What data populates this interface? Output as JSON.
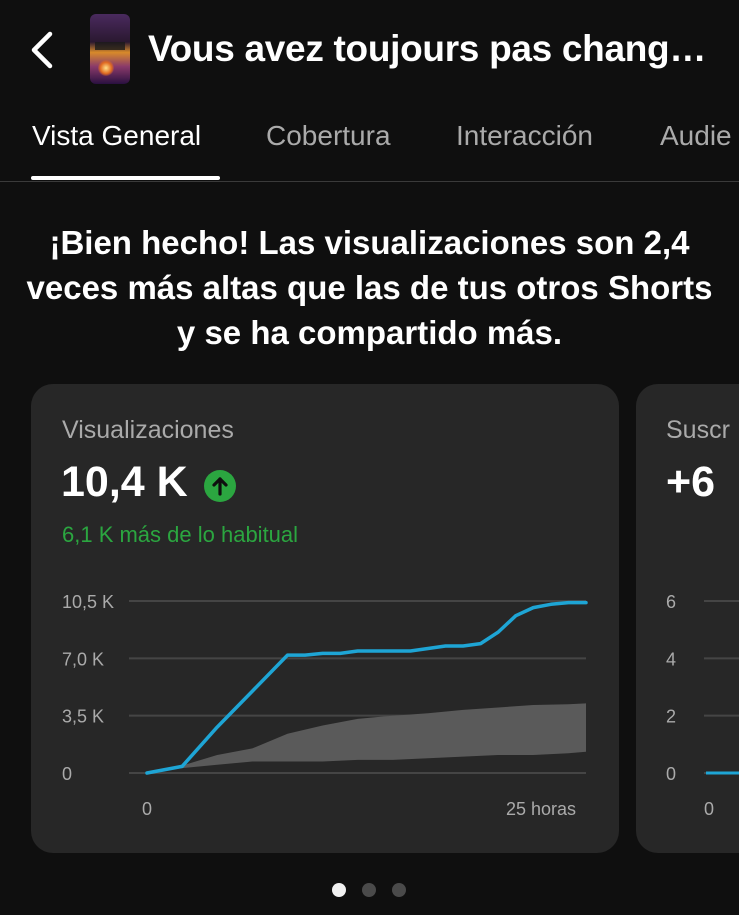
{
  "header": {
    "title": "Vous avez toujours pas chang…",
    "back_icon": "back-arrow-icon",
    "thumbnail": "video-thumbnail"
  },
  "tabs": [
    {
      "label": "Vista General",
      "active": true
    },
    {
      "label": "Cobertura",
      "active": false
    },
    {
      "label": "Interacción",
      "active": false
    },
    {
      "label": "Audie",
      "active": false
    }
  ],
  "headline": "¡Bien hecho! Las visualizaciones son 2,4 veces más altas que las de tus otros Shorts y se ha compartido más.",
  "cards": [
    {
      "label": "Visualizaciones",
      "value": "10,4 K",
      "trend_icon": "arrow-up-icon",
      "note": "6,1 K más de lo habitual",
      "note_color": "#2ba640"
    },
    {
      "label": "Suscr",
      "value": "+6"
    }
  ],
  "colors": {
    "background": "#0f0f0f",
    "card": "#272727",
    "line": "#1ea5d5",
    "typical_band": "#5a5a5a",
    "positive": "#2ba640"
  },
  "chart_data": [
    {
      "type": "line",
      "title": "Visualizaciones",
      "x_unit": "horas",
      "xlim": [
        0,
        25
      ],
      "ylim": [
        0,
        10500
      ],
      "y_ticks": [
        0,
        3500,
        7000,
        10500
      ],
      "y_tick_labels": [
        "0",
        "3,5 K",
        "7,0 K",
        "10,5 K"
      ],
      "x_tick_labels": [
        "0",
        "25 horas"
      ],
      "grid": true,
      "series": [
        {
          "kind": "line",
          "x": [
            0,
            2,
            4,
            6,
            8,
            9,
            10,
            11,
            12,
            13,
            15,
            16,
            17,
            18,
            19,
            20,
            21,
            22,
            23,
            24,
            25
          ],
          "values": [
            0,
            400,
            2800,
            5000,
            7200,
            7200,
            7300,
            7300,
            7450,
            7450,
            7450,
            7600,
            7750,
            7750,
            7900,
            8600,
            9600,
            10100,
            10300,
            10400,
            10400
          ]
        },
        {
          "kind": "band",
          "x": [
            0,
            2,
            4,
            6,
            8,
            10,
            12,
            14,
            16,
            18,
            20,
            22,
            24,
            25
          ],
          "low": [
            0,
            300,
            500,
            700,
            700,
            700,
            800,
            800,
            900,
            1000,
            1100,
            1100,
            1200,
            1300
          ],
          "high": [
            0,
            450,
            1100,
            1500,
            2400,
            2900,
            3300,
            3500,
            3650,
            3850,
            4000,
            4150,
            4200,
            4250
          ]
        }
      ]
    },
    {
      "type": "line",
      "title": "Suscr",
      "ylim": [
        0,
        6
      ],
      "y_ticks": [
        0,
        2,
        4,
        6
      ],
      "y_tick_labels": [
        "0",
        "2",
        "4",
        "6"
      ],
      "x_tick_labels": [
        "0"
      ],
      "grid": true,
      "series": [
        {
          "kind": "line",
          "x": [
            0,
            1
          ],
          "values": [
            0,
            0
          ]
        }
      ]
    }
  ],
  "pager": {
    "count": 3,
    "active": 0
  }
}
